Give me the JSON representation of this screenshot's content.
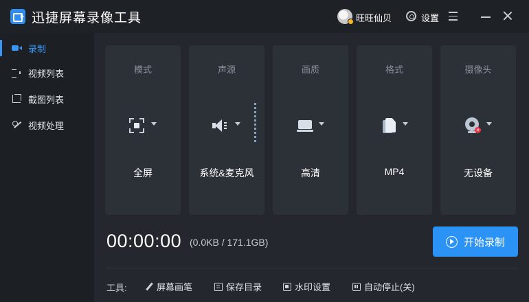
{
  "app": {
    "title": "迅捷屏幕录像工具"
  },
  "header": {
    "username": "旺旺仙贝",
    "settings_label": "设置"
  },
  "sidebar": {
    "items": [
      {
        "label": "录制",
        "icon": "record-video-icon",
        "active": true
      },
      {
        "label": "视频列表",
        "icon": "video-list-icon",
        "active": false
      },
      {
        "label": "截图列表",
        "icon": "screenshot-list-icon",
        "active": false
      },
      {
        "label": "视频处理",
        "icon": "video-process-icon",
        "active": false
      }
    ]
  },
  "cards": [
    {
      "title": "模式",
      "value": "全屏",
      "icon": "fullscreen-icon"
    },
    {
      "title": "声源",
      "value": "系统&麦克风",
      "icon": "speaker-icon"
    },
    {
      "title": "画质",
      "value": "高清",
      "icon": "laptop-icon"
    },
    {
      "title": "格式",
      "value": "MP4",
      "icon": "file-icon"
    },
    {
      "title": "摄像头",
      "value": "无设备",
      "icon": "webcam-icon"
    }
  ],
  "recording": {
    "timer": "00:00:00",
    "size": "(0.0KB / 171.1GB)",
    "start_label": "开始录制"
  },
  "tools": {
    "label": "工具:",
    "items": [
      {
        "label": "屏幕画笔",
        "icon": "pen-icon"
      },
      {
        "label": "保存目录",
        "icon": "folder-doc-icon"
      },
      {
        "label": "水印设置",
        "icon": "watermark-icon"
      },
      {
        "label": "自动停止(关)",
        "icon": "auto-stop-icon"
      }
    ]
  },
  "colors": {
    "accent": "#2b93f5",
    "active_text": "#3a95f3",
    "bg": "#24272d",
    "card": "#2c3037"
  }
}
